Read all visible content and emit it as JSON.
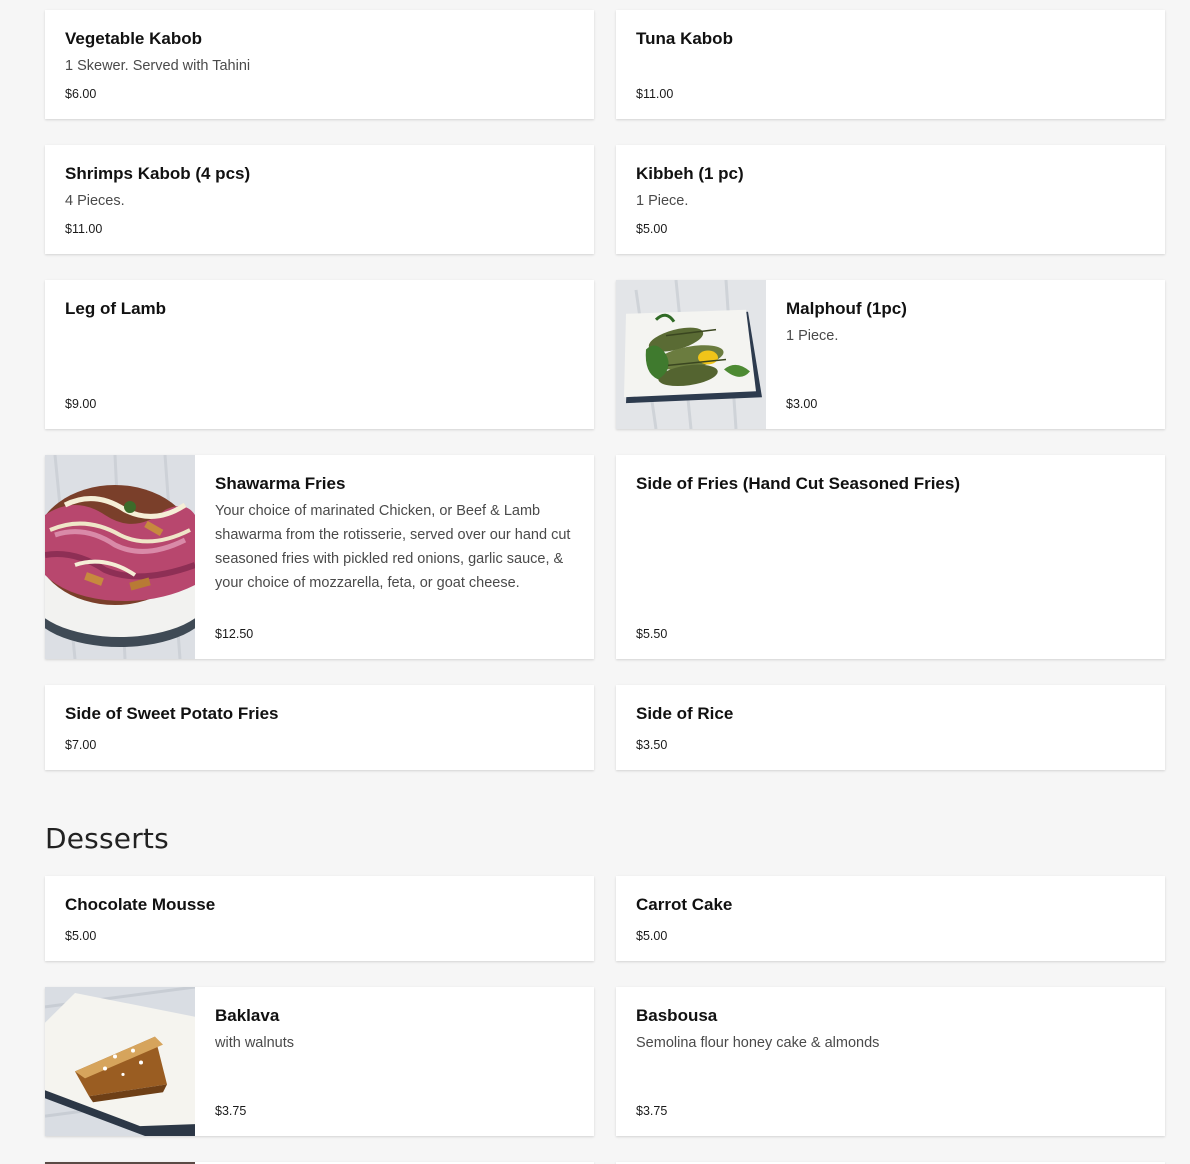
{
  "sections": {
    "desserts_title": "Desserts"
  },
  "items": {
    "vegetable_kabob": {
      "name": "Vegetable Kabob",
      "description": "1 Skewer. Served with Tahini",
      "price": "$6.00"
    },
    "tuna_kabob": {
      "name": "Tuna Kabob",
      "description": "",
      "price": "$11.00"
    },
    "shrimps_kabob": {
      "name": "Shrimps Kabob (4 pcs)",
      "description": "4 Pieces.",
      "price": "$11.00"
    },
    "kibbeh": {
      "name": "Kibbeh (1 pc)",
      "description": "1 Piece.",
      "price": "$5.00"
    },
    "leg_of_lamb": {
      "name": "Leg of Lamb",
      "description": "",
      "price": "$9.00"
    },
    "malphouf": {
      "name": "Malphouf (1pc)",
      "description": "1 Piece.",
      "price": "$3.00"
    },
    "shawarma_fries": {
      "name": "Shawarma Fries",
      "description": "Your choice of marinated Chicken, or Beef & Lamb shawarma from the rotisserie, served over our hand cut seasoned fries with pickled red onions, garlic sauce, & your choice of mozzarella, feta, or goat cheese.",
      "price": "$12.50"
    },
    "side_of_fries": {
      "name": "Side of Fries (Hand Cut Seasoned Fries)",
      "description": "",
      "price": "$5.50"
    },
    "side_sweet_potato_fries": {
      "name": "Side of Sweet Potato Fries",
      "description": "",
      "price": "$7.00"
    },
    "side_of_rice": {
      "name": "Side of Rice",
      "description": "",
      "price": "$3.50"
    },
    "chocolate_mousse": {
      "name": "Chocolate Mousse",
      "description": "",
      "price": "$5.00"
    },
    "carrot_cake": {
      "name": "Carrot Cake",
      "description": "",
      "price": "$5.00"
    },
    "baklava": {
      "name": "Baklava",
      "description": "with walnuts",
      "price": "$3.75"
    },
    "basbousa": {
      "name": "Basbousa",
      "description": "Semolina flour honey cake & almonds",
      "price": "$3.75"
    }
  },
  "colors": {
    "background": "#f6f6f6",
    "card": "#ffffff",
    "text_primary": "#111111",
    "text_secondary": "#4a4a4a"
  }
}
